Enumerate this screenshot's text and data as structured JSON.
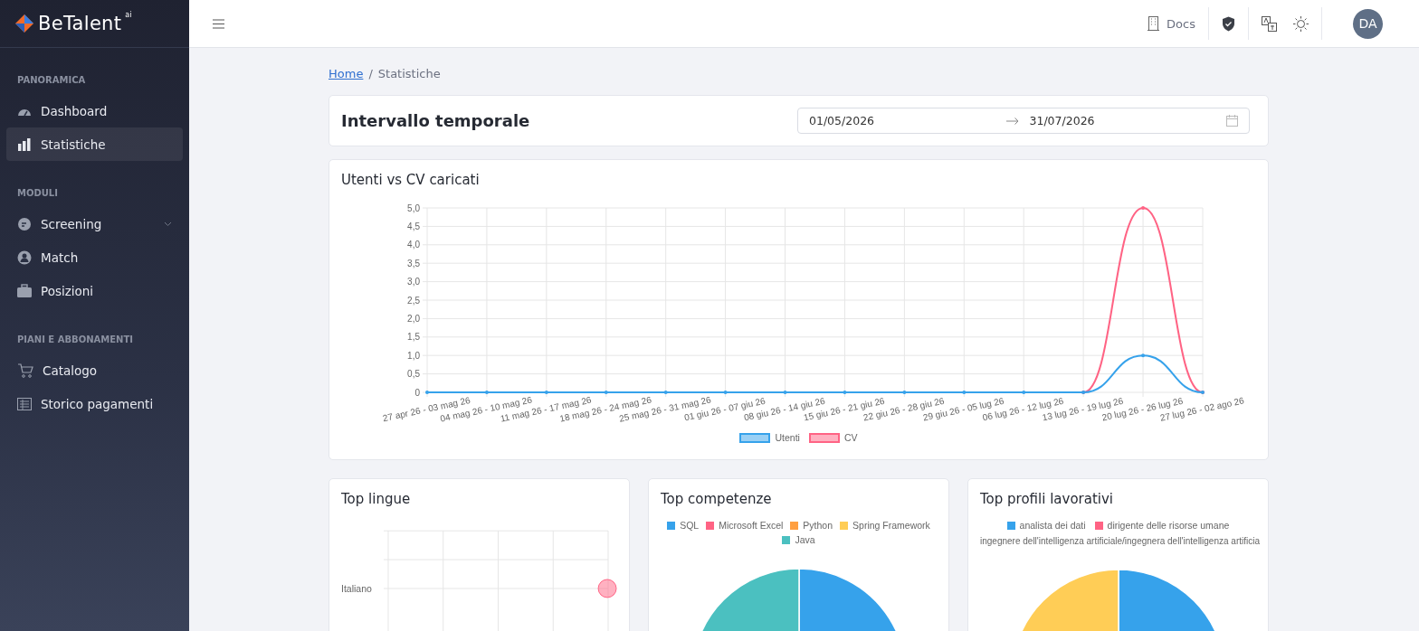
{
  "brand": {
    "name": "BeTalent",
    "suffix": "ai"
  },
  "sidebar": {
    "sections": [
      {
        "title": "PANORAMICA",
        "items": [
          {
            "label": "Dashboard",
            "selected": false
          },
          {
            "label": "Statistiche",
            "selected": true
          }
        ]
      },
      {
        "title": "MODULI",
        "items": [
          {
            "label": "Screening",
            "selected": false,
            "expanded": false
          },
          {
            "label": "Match",
            "selected": false
          },
          {
            "label": "Posizioni",
            "selected": false
          }
        ]
      },
      {
        "title": "PIANI E ABBONAMENTI",
        "items": [
          {
            "label": "Catalogo",
            "selected": false
          },
          {
            "label": "Storico pagamenti",
            "selected": false
          }
        ]
      }
    ]
  },
  "topbar": {
    "docs": "Docs",
    "avatar": "DA"
  },
  "breadcrumb": [
    {
      "label": "Home",
      "kind": "link"
    },
    {
      "label": "Statistiche",
      "kind": "current"
    }
  ],
  "breadcrumb_separator": "/",
  "range": {
    "title": "Intervallo temporale",
    "start": "01/05/2026",
    "end": "31/07/2026"
  },
  "line_card": {
    "title": "Utenti vs CV caricati",
    "chart_data": {
      "type": "line",
      "categories": [
        "27 apr 26 - 03 mag 26",
        "04 mag 26 - 10 mag 26",
        "11 mag 26 - 17 mag 26",
        "18 mag 26 - 24 mag 26",
        "25 mag 26 - 31 mag 26",
        "01 giu 26 - 07 giu 26",
        "08 giu 26 - 14 giu 26",
        "15 giu 26 - 21 giu 26",
        "22 giu 26 - 28 giu 26",
        "29 giu 26 - 05 lug 26",
        "06 lug 26 - 12 lug 26",
        "13 lug 26 - 19 lug 26",
        "20 lug 26 - 26 lug 26",
        "27 lug 26 - 02 ago 26"
      ],
      "series": [
        {
          "name": "Utenti",
          "color": "#36a2eb",
          "values": [
            0,
            0,
            0,
            0,
            0,
            0,
            0,
            0,
            0,
            0,
            0,
            0,
            1,
            0
          ]
        },
        {
          "name": "CV",
          "color": "#ff6384",
          "values": [
            null,
            null,
            null,
            null,
            null,
            null,
            null,
            null,
            null,
            null,
            null,
            0,
            5,
            0
          ]
        }
      ],
      "grid": true,
      "ylim": [
        0,
        5
      ],
      "yticks": [
        {
          "value": 0,
          "label": "0"
        },
        {
          "value": 0.5,
          "label": "0,5"
        },
        {
          "value": 1,
          "label": "1,0"
        },
        {
          "value": 1.5,
          "label": "1,5"
        },
        {
          "value": 2,
          "label": "2,0"
        },
        {
          "value": 2.5,
          "label": "2,5"
        },
        {
          "value": 3,
          "label": "3,0"
        },
        {
          "value": 3.5,
          "label": "3,5"
        },
        {
          "value": 4,
          "label": "4,0"
        },
        {
          "value": 4.5,
          "label": "4,5"
        },
        {
          "value": 5,
          "label": "5,0"
        }
      ]
    }
  },
  "languages_card": {
    "title": "Top lingue",
    "category": "Italiano"
  },
  "skills_card": {
    "title": "Top competenze",
    "legend": [
      {
        "label": "SQL",
        "color": "#36a2eb"
      },
      {
        "label": "Microsoft Excel",
        "color": "#ff6384"
      },
      {
        "label": "Python",
        "color": "#ff9f40"
      },
      {
        "label": "Spring Framework",
        "color": "#ffcd56"
      },
      {
        "label": "Java",
        "color": "#4bc0c0"
      }
    ]
  },
  "profiles_card": {
    "title": "Top profili lavorativi",
    "legend": [
      {
        "label": "analista dei dati",
        "color": "#36a2eb"
      },
      {
        "label": "dirigente delle risorse umane",
        "color": "#ff6384"
      }
    ],
    "legend_cut": "ingegnere dell'intelligenza artificiale/ingegnera dell'intelligenza artificia"
  }
}
